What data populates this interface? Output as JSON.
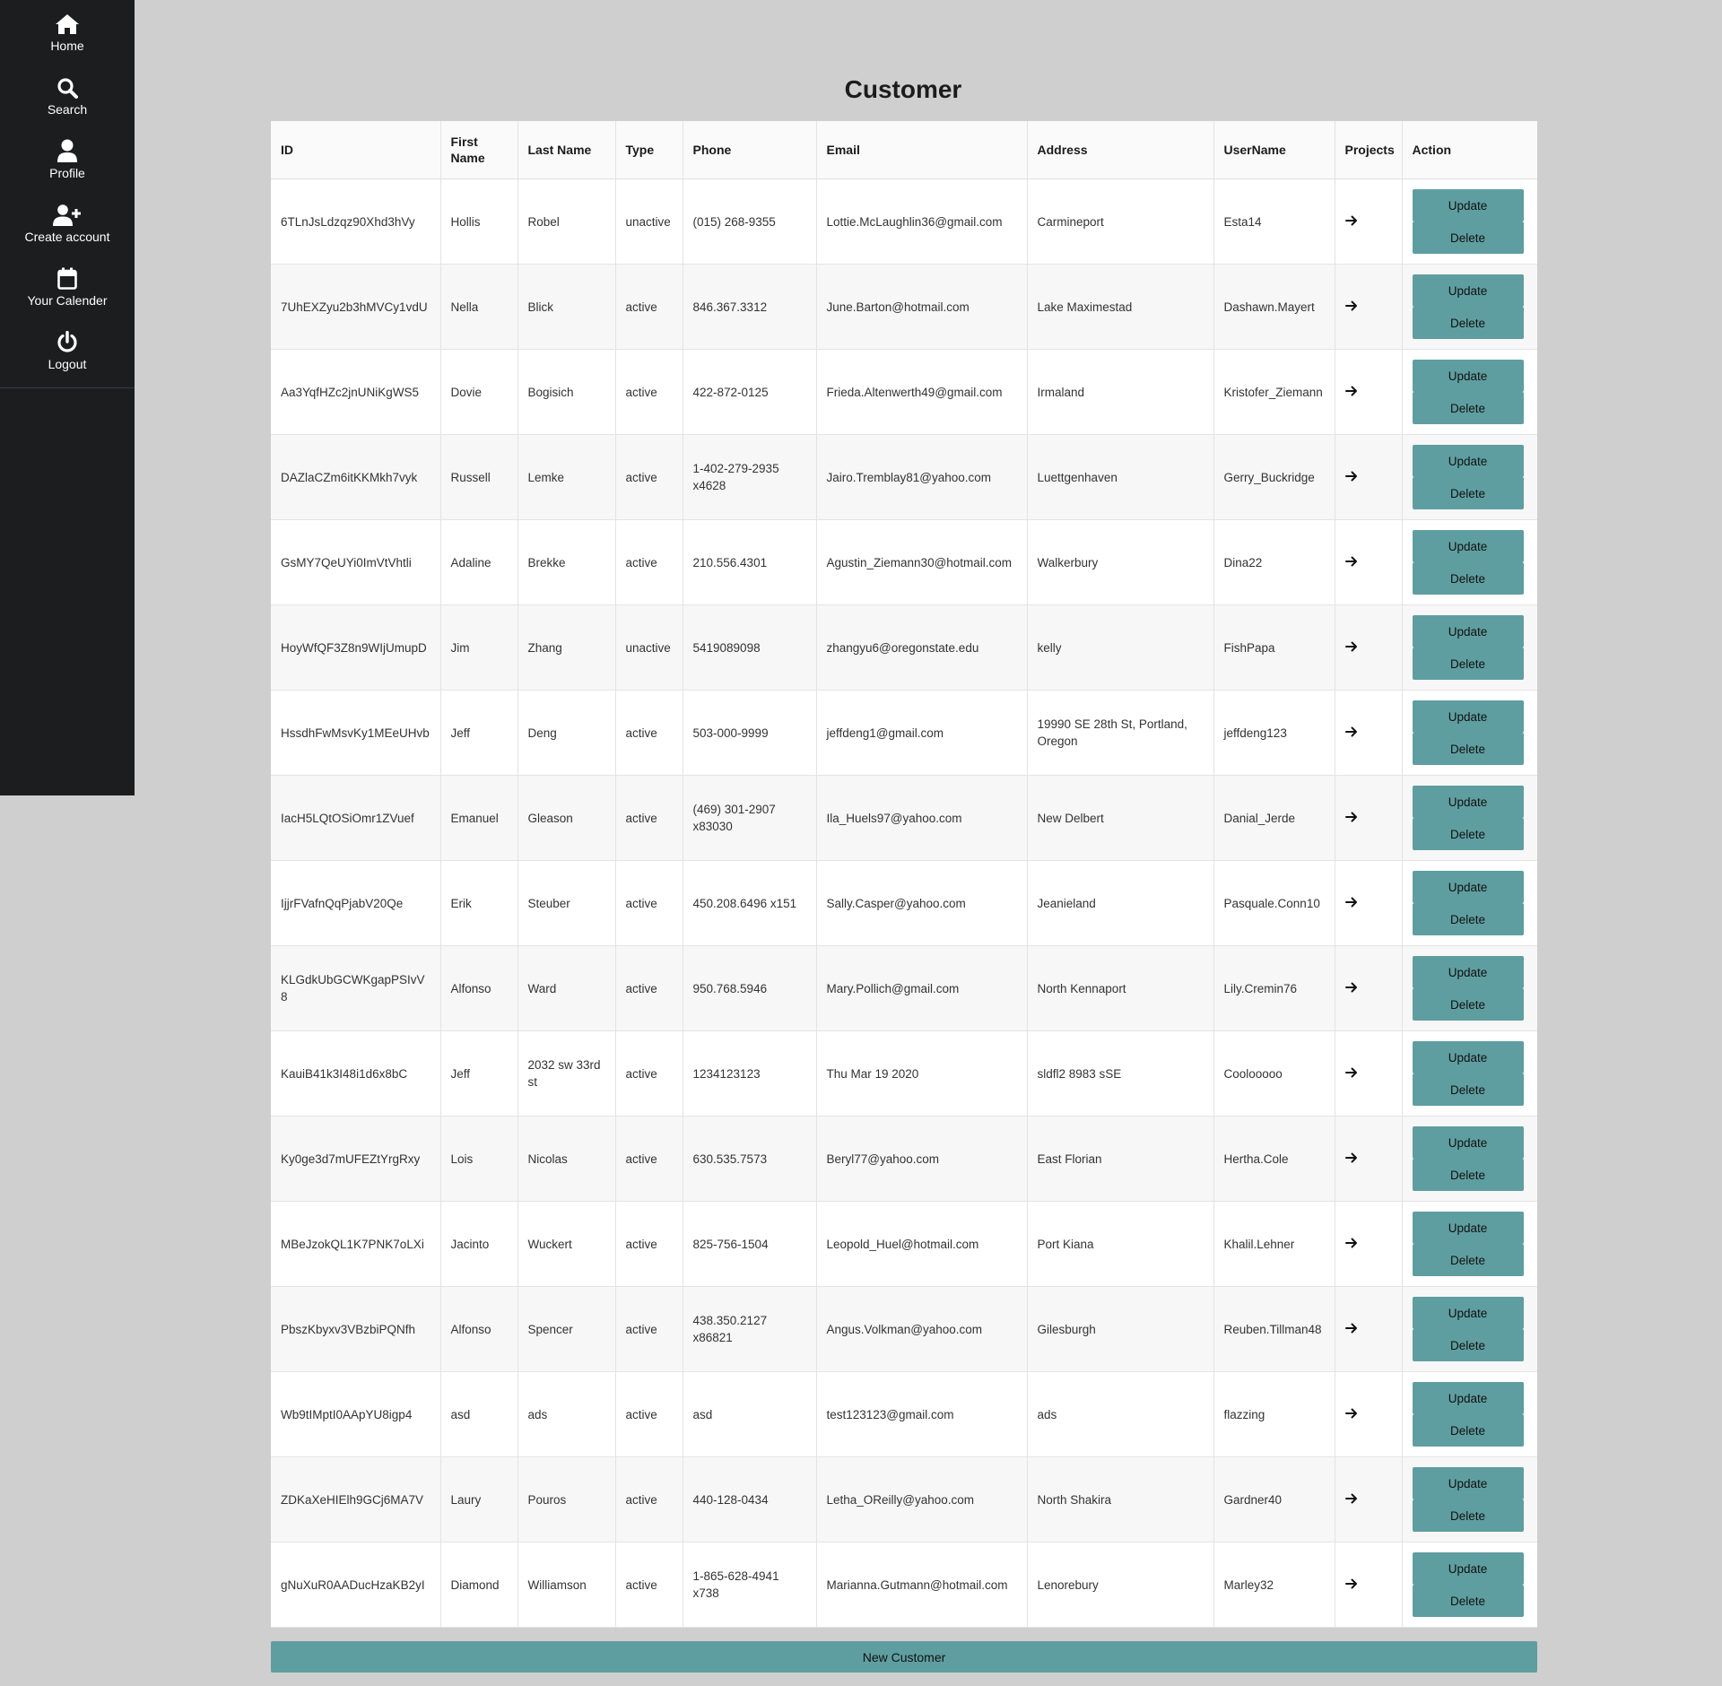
{
  "sidebar": {
    "items": [
      {
        "label": "Home",
        "icon": "home-icon"
      },
      {
        "label": "Search",
        "icon": "search-icon"
      },
      {
        "label": "Profile",
        "icon": "user-icon"
      },
      {
        "label": "Create account",
        "icon": "user-plus-icon"
      },
      {
        "label": "Your Calender",
        "icon": "calendar-icon"
      },
      {
        "label": "Logout",
        "icon": "power-icon"
      }
    ]
  },
  "page": {
    "title": "Customer"
  },
  "table": {
    "columns": [
      "ID",
      "First Name",
      "Last Name",
      "Type",
      "Phone",
      "Email",
      "Address",
      "UserName",
      "Projects",
      "Action"
    ],
    "update_label": "Update",
    "delete_label": "Delete",
    "rows": [
      {
        "id": "6TLnJsLdzqz90Xhd3hVy",
        "first": "Hollis",
        "last": "Robel",
        "type": "unactive",
        "phone": "(015) 268-9355",
        "email": "Lottie.McLaughlin36@gmail.com",
        "address": "Carmineport",
        "username": "Esta14"
      },
      {
        "id": "7UhEXZyu2b3hMVCy1vdU",
        "first": "Nella",
        "last": "Blick",
        "type": "active",
        "phone": "846.367.3312",
        "email": "June.Barton@hotmail.com",
        "address": "Lake Maximestad",
        "username": "Dashawn.Mayert"
      },
      {
        "id": "Aa3YqfHZc2jnUNiKgWS5",
        "first": "Dovie",
        "last": "Bogisich",
        "type": "active",
        "phone": "422-872-0125",
        "email": "Frieda.Altenwerth49@gmail.com",
        "address": "Irmaland",
        "username": "Kristofer_Ziemann"
      },
      {
        "id": "DAZlaCZm6itKKMkh7vyk",
        "first": "Russell",
        "last": "Lemke",
        "type": "active",
        "phone": "1-402-279-2935 x4628",
        "email": "Jairo.Tremblay81@yahoo.com",
        "address": "Luettgenhaven",
        "username": "Gerry_Buckridge"
      },
      {
        "id": "GsMY7QeUYi0ImVtVhtli",
        "first": "Adaline",
        "last": "Brekke",
        "type": "active",
        "phone": "210.556.4301",
        "email": "Agustin_Ziemann30@hotmail.com",
        "address": "Walkerbury",
        "username": "Dina22"
      },
      {
        "id": "HoyWfQF3Z8n9WIjUmupD",
        "first": "Jim",
        "last": "Zhang",
        "type": "unactive",
        "phone": "5419089098",
        "email": "zhangyu6@oregonstate.edu",
        "address": "kelly",
        "username": "FishPapa"
      },
      {
        "id": "HssdhFwMsvKy1MEeUHvb",
        "first": "Jeff",
        "last": "Deng",
        "type": "active",
        "phone": "503-000-9999",
        "email": "jeffdeng1@gmail.com",
        "address": "19990 SE 28th St, Portland, Oregon",
        "username": "jeffdeng123"
      },
      {
        "id": "IacH5LQtOSiOmr1ZVuef",
        "first": "Emanuel",
        "last": "Gleason",
        "type": "active",
        "phone": "(469) 301-2907 x83030",
        "email": "Ila_Huels97@yahoo.com",
        "address": "New Delbert",
        "username": "Danial_Jerde"
      },
      {
        "id": "IjjrFVafnQqPjabV20Qe",
        "first": "Erik",
        "last": "Steuber",
        "type": "active",
        "phone": "450.208.6496 x151",
        "email": "Sally.Casper@yahoo.com",
        "address": "Jeanieland",
        "username": "Pasquale.Conn10"
      },
      {
        "id": "KLGdkUbGCWKgapPSIvV8",
        "first": "Alfonso",
        "last": "Ward",
        "type": "active",
        "phone": "950.768.5946",
        "email": "Mary.Pollich@gmail.com",
        "address": "North Kennaport",
        "username": "Lily.Cremin76"
      },
      {
        "id": "KauiB41k3I48i1d6x8bC",
        "first": "Jeff",
        "last": "2032 sw 33rd st",
        "type": "active",
        "phone": "1234123123",
        "email": "Thu Mar 19 2020",
        "address": "sldfl2 8983 sSE",
        "username": "Coolooooo"
      },
      {
        "id": "Ky0ge3d7mUFEZtYrgRxy",
        "first": "Lois",
        "last": "Nicolas",
        "type": "active",
        "phone": "630.535.7573",
        "email": "Beryl77@yahoo.com",
        "address": "East Florian",
        "username": "Hertha.Cole"
      },
      {
        "id": "MBeJzokQL1K7PNK7oLXi",
        "first": "Jacinto",
        "last": "Wuckert",
        "type": "active",
        "phone": "825-756-1504",
        "email": "Leopold_Huel@hotmail.com",
        "address": "Port Kiana",
        "username": "Khalil.Lehner"
      },
      {
        "id": "PbszKbyxv3VBzbiPQNfh",
        "first": "Alfonso",
        "last": "Spencer",
        "type": "active",
        "phone": "438.350.2127 x86821",
        "email": "Angus.Volkman@yahoo.com",
        "address": "Gilesburgh",
        "username": "Reuben.Tillman48"
      },
      {
        "id": "Wb9tIMptI0AApYU8igp4",
        "first": "asd",
        "last": "ads",
        "type": "active",
        "phone": "asd",
        "email": "test123123@gmail.com",
        "address": "ads",
        "username": "flazzing"
      },
      {
        "id": "ZDKaXeHIElh9GCj6MA7V",
        "first": "Laury",
        "last": "Pouros",
        "type": "active",
        "phone": "440-128-0434",
        "email": "Letha_OReilly@yahoo.com",
        "address": "North Shakira",
        "username": "Gardner40"
      },
      {
        "id": "gNuXuR0AADucHzaKB2yI",
        "first": "Diamond",
        "last": "Williamson",
        "type": "active",
        "phone": "1-865-628-4941 x738",
        "email": "Marianna.Gutmann@hotmail.com",
        "address": "Lenorebury",
        "username": "Marley32"
      }
    ]
  },
  "footer": {
    "new_customer_label": "New Customer"
  },
  "colors": {
    "accent": "#5f9ea0",
    "sidebar": "#1c1d1f",
    "background": "#d0cfd0"
  }
}
